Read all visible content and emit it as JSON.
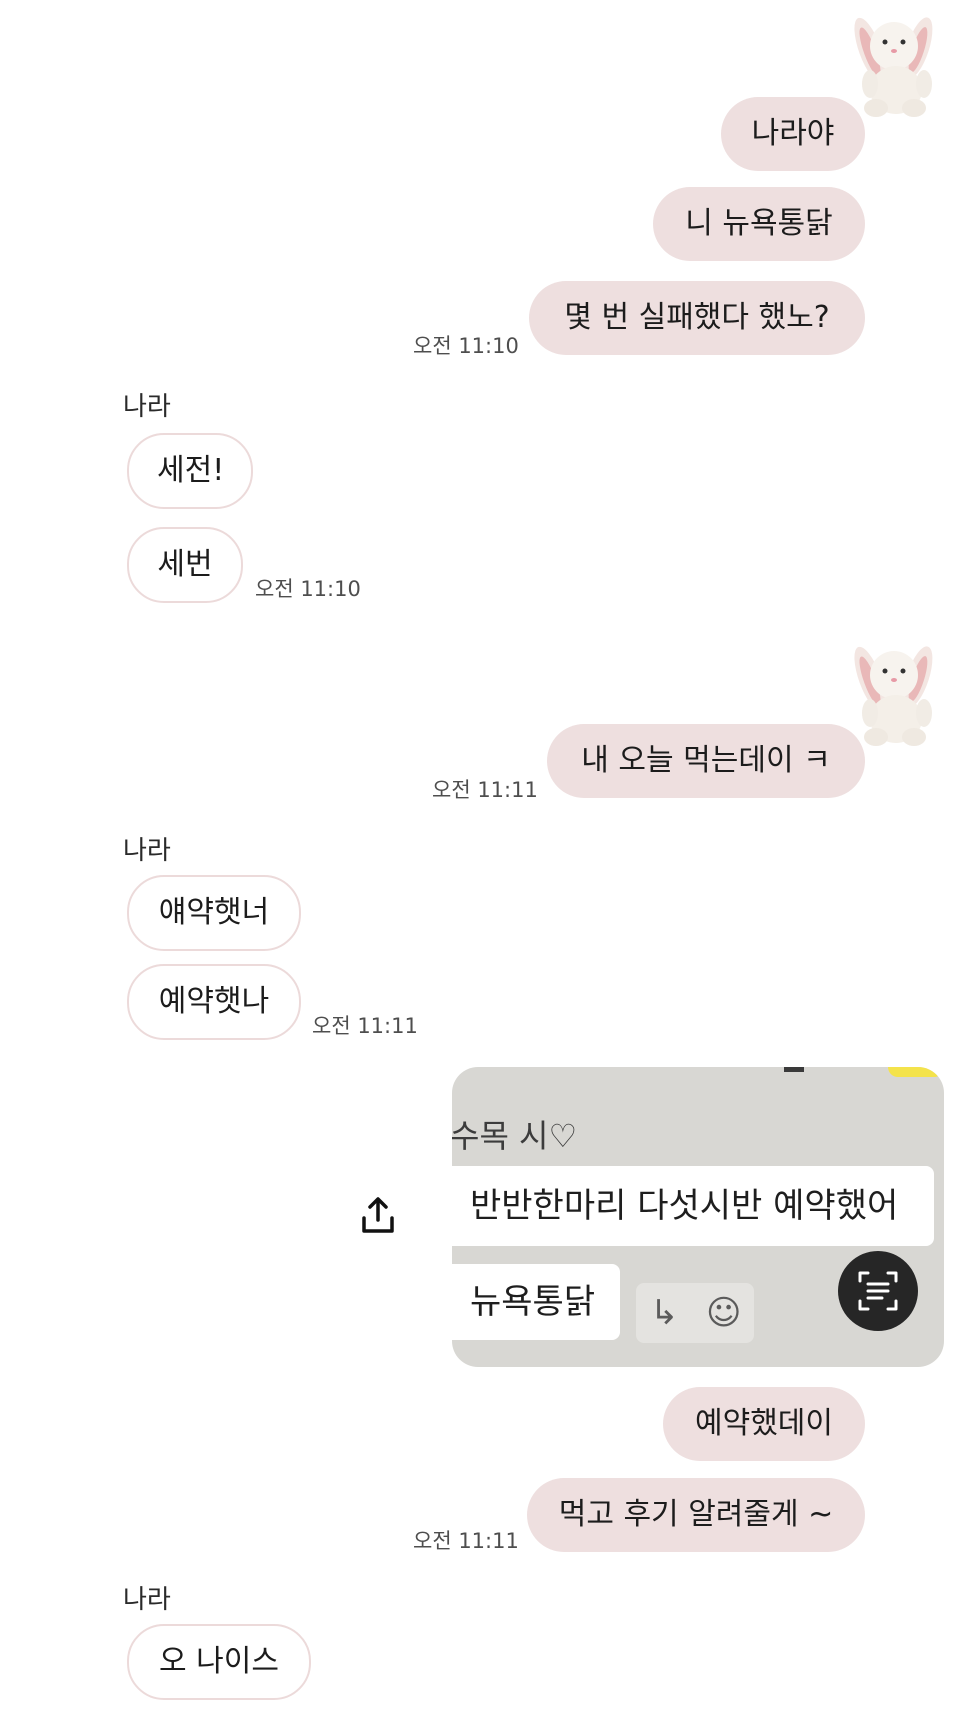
{
  "messages": {
    "block1": {
      "mine": [
        "나라야",
        "니 뉴욕통닭",
        "몇 번 실패했다 했노?"
      ],
      "time": "오전 11:10"
    },
    "block2": {
      "sender": "나라",
      "theirs": [
        "세전!",
        "세번"
      ],
      "time": "오전 11:10"
    },
    "block3": {
      "mine": [
        "내 오늘 먹는데이 ㅋ"
      ],
      "time": "오전 11:11"
    },
    "block4": {
      "sender": "나라",
      "theirs": [
        "얘약햇너",
        "예약햇나"
      ],
      "time": "오전 11:11"
    },
    "block5": {
      "photo": {
        "heading": "수목 시♡",
        "line1": "반반한마리 다섯시반 예약했어",
        "line2": "뉴욕통닭",
        "reply_glyph": "↳",
        "emoji_glyph": "☺"
      },
      "mine": [
        "예약했데이",
        "먹고 후기 알려줄게 ~"
      ],
      "time": "오전 11:11"
    },
    "block6": {
      "sender": "나라",
      "theirs": [
        "오 나이스"
      ]
    }
  },
  "icons": {
    "avatar": "bunny-plush-avatar",
    "share": "share-upload-icon",
    "scan": "text-scan-icon"
  },
  "colors": {
    "mine_bubble": "#eedfdf",
    "theirs_border": "#ecdada",
    "background": "#ffffff"
  }
}
